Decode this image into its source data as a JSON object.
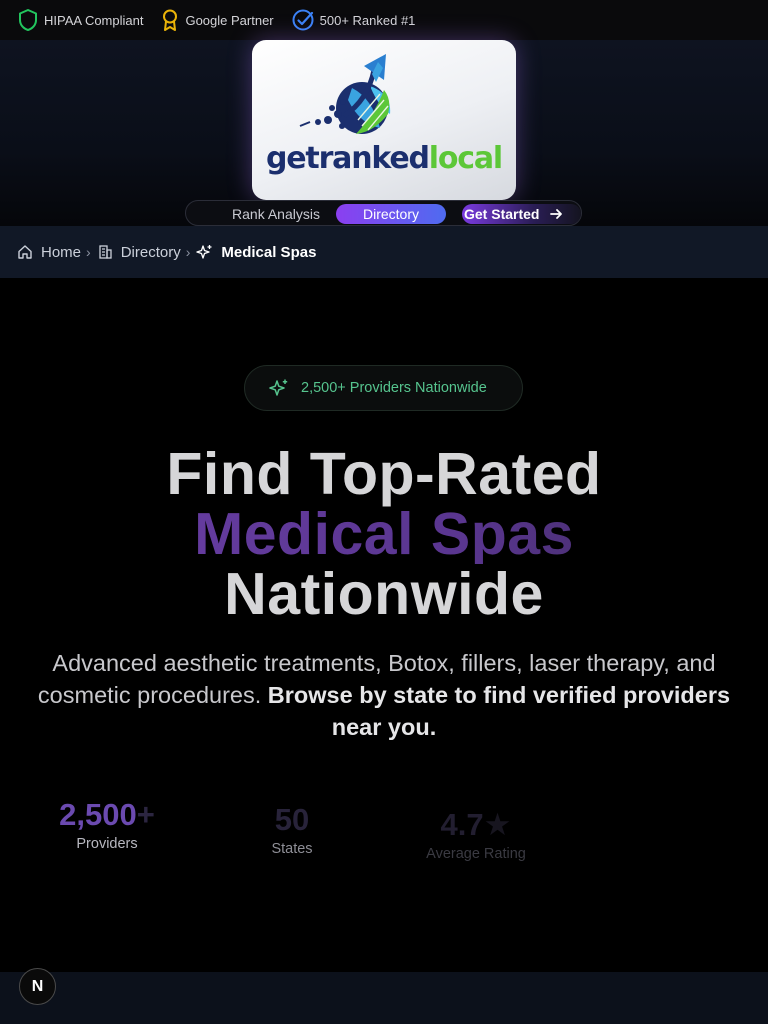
{
  "trust_bar": {
    "items": [
      {
        "label": "HIPAA Compliant",
        "icon": "shield-icon",
        "color": "#22c55e"
      },
      {
        "label": "Google Partner",
        "icon": "award-icon",
        "color": "#eab308"
      },
      {
        "label": "500+ Ranked #1",
        "icon": "check-circle-icon",
        "color": "#3b82f6"
      }
    ]
  },
  "logo": {
    "text_part1": "getranked",
    "text_part2": "local"
  },
  "nav": {
    "rank_analysis": "Rank Analysis",
    "directory": "Directory",
    "get_started": "Get Started"
  },
  "breadcrumb": {
    "home": "Home",
    "directory": "Directory",
    "current": "Medical Spas"
  },
  "hero": {
    "badge": "2,500+ Providers Nationwide",
    "title_line1": "Find Top-Rated",
    "title_line2": "Medical Spas",
    "title_line3": "Nationwide",
    "subtitle": "Advanced aesthetic treatments, Botox, fillers, laser therapy, and cosmetic procedures.",
    "subtitle_bold": "Browse by state to find verified providers near you."
  },
  "stats": [
    {
      "value": "2,500",
      "suffix": "+",
      "label": "Providers"
    },
    {
      "value": "50",
      "suffix": "",
      "label": "States"
    },
    {
      "value": "4.7",
      "suffix": "★",
      "label": "Average Rating"
    }
  ],
  "dev_badge": "N",
  "colors": {
    "accent_purple": "#8b3ff0",
    "accent_blue": "#4f6bf0",
    "badge_green": "#56c48e"
  }
}
